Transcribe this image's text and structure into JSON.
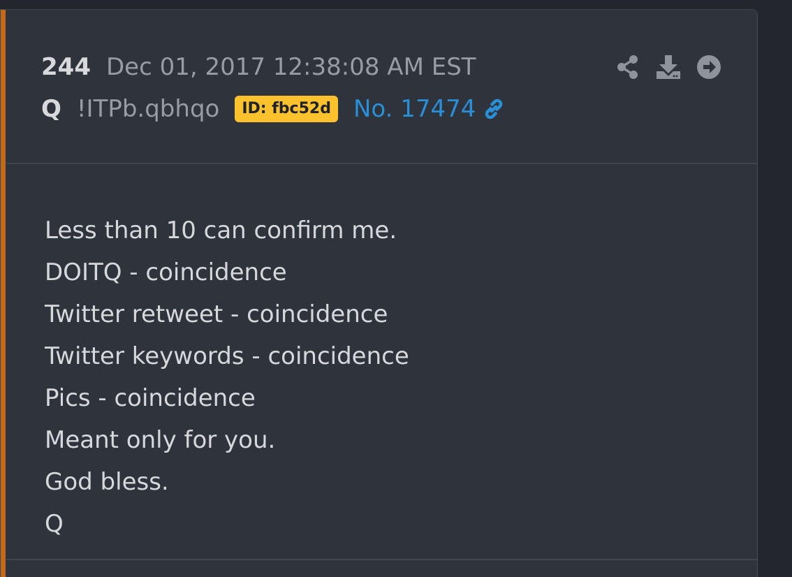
{
  "post": {
    "number": "244",
    "date": "Dec 01, 2017 12:38:08 AM EST",
    "poster": "Q",
    "tripcode": "!ITPb.qbhqo",
    "id_badge": "ID: fbc52d",
    "post_link": "No. 17474"
  },
  "actions": [
    {
      "icon": "share-icon"
    },
    {
      "icon": "download-icon"
    },
    {
      "icon": "arrow-right-circle-icon"
    }
  ],
  "body": {
    "lines": [
      "Less than 10 can confirm me.",
      "DOITQ - coincidence",
      "Twitter retweet - coincidence",
      "Twitter keywords - coincidence",
      "Pics - coincidence",
      "Meant only for you.",
      "God bless.",
      "Q"
    ]
  },
  "colors": {
    "accent": "#c26a1a",
    "badge": "#fcc22d",
    "link": "#2a8fd6",
    "background": "#2e333c"
  }
}
